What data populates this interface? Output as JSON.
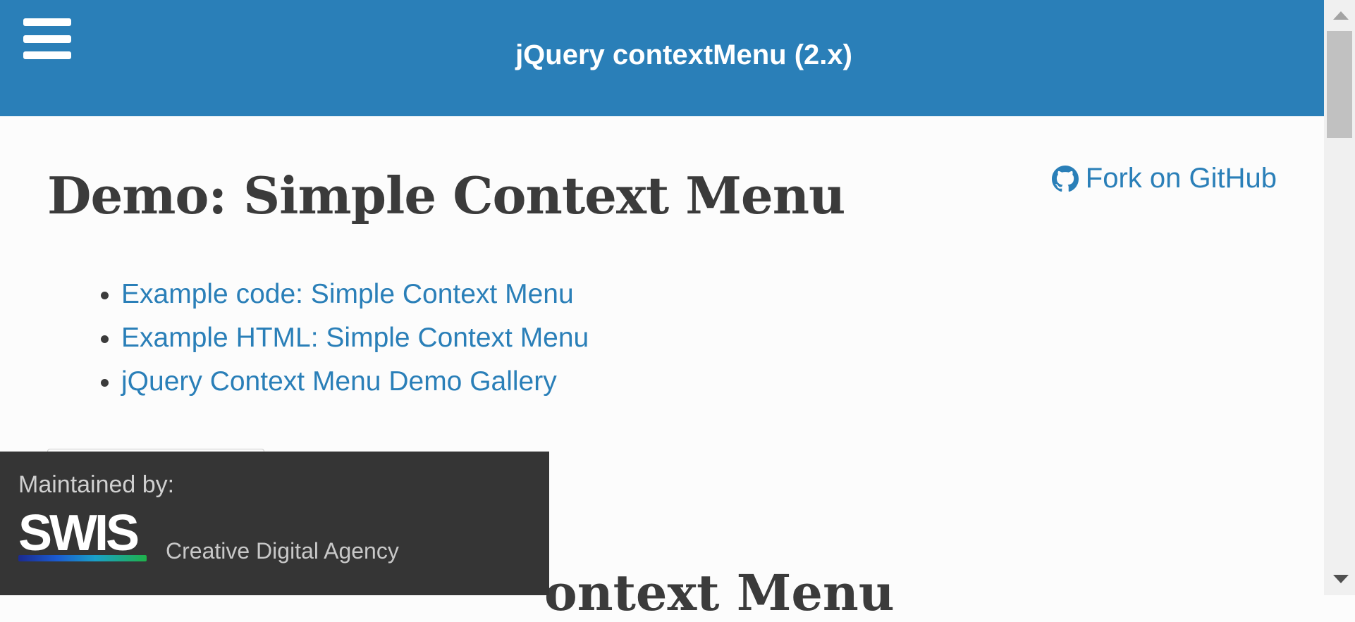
{
  "header": {
    "title": "jQuery contextMenu (2.x)",
    "menu_icon": "hamburger-menu-icon"
  },
  "main": {
    "github_icon": "github-icon",
    "github_label": "Fork on GitHub",
    "page_title": "Demo: Simple Context Menu",
    "links": [
      {
        "label": "Example code: Simple Context Menu"
      },
      {
        "label": "Example HTML: Simple Context Menu"
      },
      {
        "label": "jQuery Context Menu Demo Gallery"
      }
    ],
    "section_title_partial": "ontext Menu"
  },
  "maintainer": {
    "label": "Maintained by:",
    "logo_text": "SWIS",
    "tagline": "Creative Digital Agency"
  },
  "colors": {
    "header_bg": "#2a7fb8",
    "link": "#2a7fb8",
    "footer_bg": "#353535",
    "text": "#3b3b3b"
  }
}
